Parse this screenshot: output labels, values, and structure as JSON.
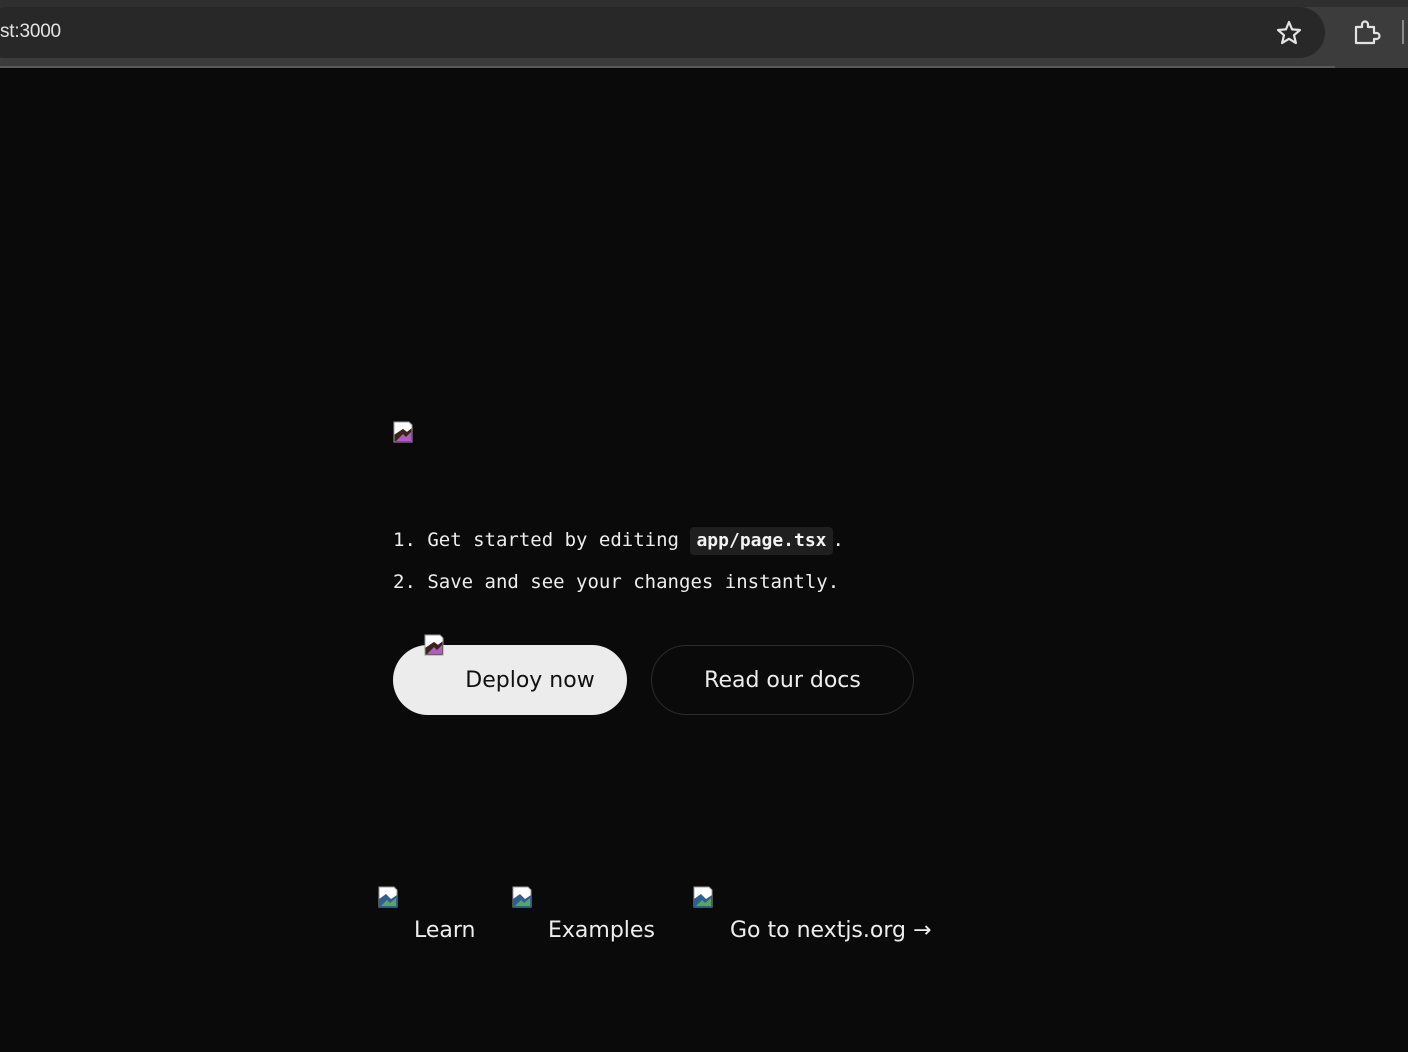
{
  "browser": {
    "address": "st:3000"
  },
  "main": {
    "steps": [
      {
        "number": "1.",
        "text_before": "Get started by editing",
        "code": "app/page.tsx",
        "text_after": "."
      },
      {
        "number": "2.",
        "text": "Save and see your changes instantly."
      }
    ],
    "buttons": {
      "deploy_label": "Deploy now",
      "docs_label": "Read our docs"
    }
  },
  "footer": {
    "links": [
      {
        "label": "Learn"
      },
      {
        "label": "Examples"
      },
      {
        "label": "Go to nextjs.org →"
      }
    ]
  }
}
